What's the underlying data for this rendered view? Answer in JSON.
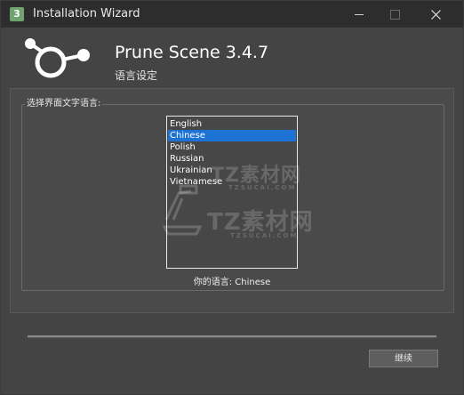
{
  "window": {
    "title": "Installation Wizard",
    "app_icon_glyph": "3"
  },
  "header": {
    "product_name": "Prune Scene 3.4.7",
    "subtitle": "语言设定"
  },
  "language_group": {
    "legend": "选择界面文字语言:",
    "options": [
      "English",
      "Chinese",
      "Polish",
      "Russian",
      "Ukrainian",
      "Vietnamese"
    ],
    "selected": "Chinese",
    "status": "你的语言: Chinese"
  },
  "footer": {
    "next_label": "继续"
  },
  "watermark": {
    "text1": "TZ素材网",
    "sub1": "TZSUCAI.COM",
    "text2": "TZ素材网",
    "sub2": "TZSUCAI.COM"
  },
  "colors": {
    "selection": "#1d73d3",
    "window_bg": "#444444",
    "titlebar_bg": "#2d2d2d"
  }
}
